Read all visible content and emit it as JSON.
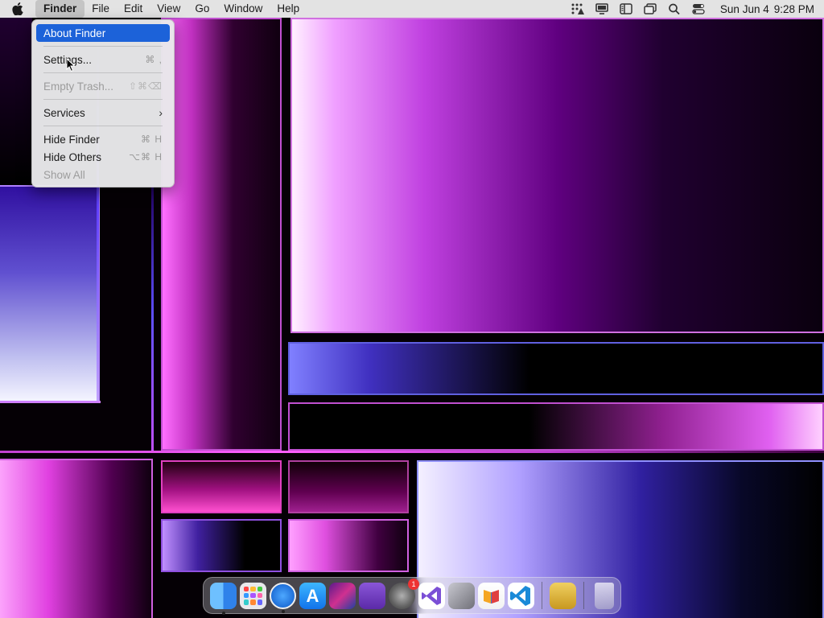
{
  "menubar": {
    "app_name": "Finder",
    "items": [
      "File",
      "Edit",
      "View",
      "Go",
      "Window",
      "Help"
    ],
    "status_icons": [
      "accessibility-icon",
      "display-icon",
      "sidebar-icon",
      "window-icon",
      "search-icon",
      "control-center-icon"
    ],
    "date": "Sun Jun 4",
    "time": "9:28 PM"
  },
  "finder_menu": {
    "items": [
      {
        "label": "About Finder",
        "shortcut": "",
        "state": "highlighted"
      },
      {
        "label": "Settings...",
        "shortcut": "⌘ ,",
        "state": "enabled"
      },
      {
        "label": "Empty Trash...",
        "shortcut": "⇧⌘⌫",
        "state": "disabled"
      },
      {
        "label": "Services",
        "shortcut": "",
        "state": "submenu"
      },
      {
        "label": "Hide Finder",
        "shortcut": "⌘ H",
        "state": "enabled"
      },
      {
        "label": "Hide Others",
        "shortcut": "⌥⌘ H",
        "state": "enabled"
      },
      {
        "label": "Show All",
        "shortcut": "",
        "state": "disabled"
      }
    ]
  },
  "dock": {
    "apps": [
      "Finder",
      "Launchpad",
      "Safari",
      "App Store",
      "Photo Editor",
      "Database",
      "System Settings",
      "Visual Studio",
      "Xcode",
      "Books",
      "Visual Studio Code",
      "Archive Utility",
      "Trash"
    ],
    "settings_badge": "1"
  },
  "colors": {
    "menu_highlight": "#1c62d9",
    "menubar_bg": "#ececec"
  }
}
